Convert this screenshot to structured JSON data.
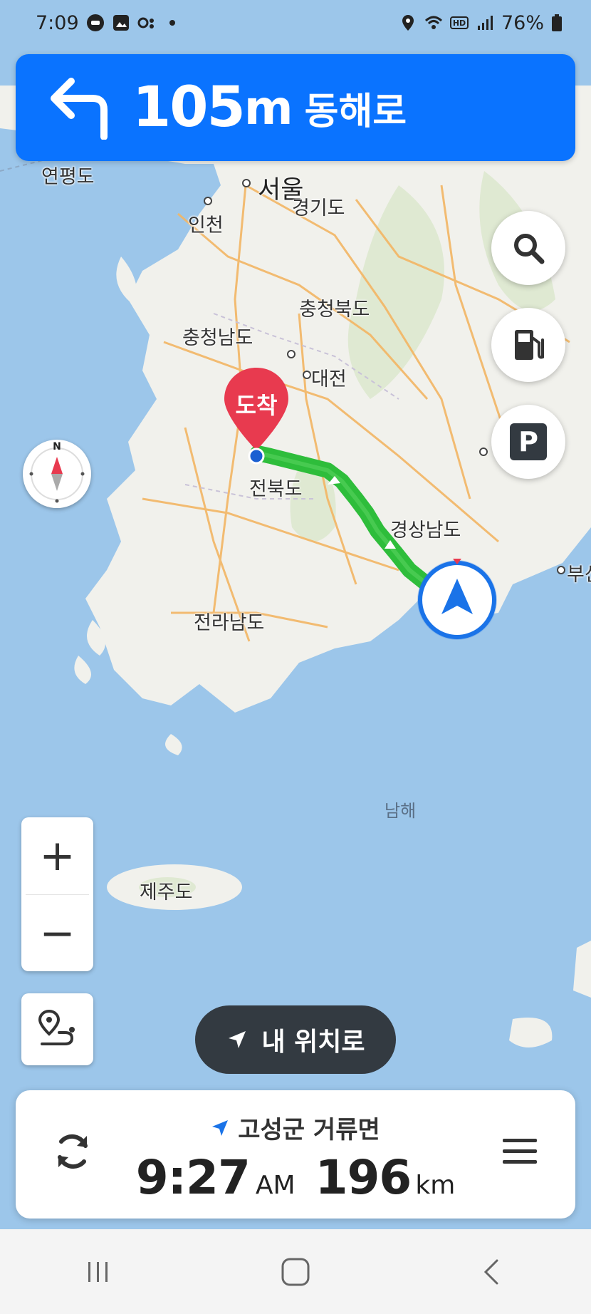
{
  "status_bar": {
    "time": "7:09",
    "battery": "76%",
    "icons_left": [
      "car-icon",
      "gallery-icon",
      "oo-icon",
      "dot-icon"
    ],
    "icons_right": [
      "location-icon",
      "wifi-icon",
      "hd-icon",
      "signal-icon",
      "battery-icon"
    ]
  },
  "guidance": {
    "turn_icon": "turn-left-arrow-icon",
    "distance": "105",
    "unit": "m",
    "road": "동해로"
  },
  "map": {
    "labels": {
      "yeonpyeong": "연평도",
      "seoul": "서울",
      "incheon": "인천",
      "gyeonggi": "경기도",
      "chungbuk": "충청북도",
      "chungnam": "충청남도",
      "daejeon": "대전",
      "jeonbuk": "전북도",
      "gyeongnam": "경상남도",
      "jeonnam": "전라남도",
      "busan": "부산",
      "namhae": "남해",
      "jeju": "제주도"
    },
    "destination_marker": "도착"
  },
  "fab_buttons": {
    "search": "search-icon",
    "fuel": "fuel-pump-icon",
    "parking": "P"
  },
  "compass": {
    "north": "N"
  },
  "zoom": {
    "in": "+",
    "out": "−"
  },
  "my_location_button": "내 위치로",
  "bottom_card": {
    "destination": "고성군 거류면",
    "eta_time": "9:27",
    "eta_ampm": "AM",
    "distance": "196",
    "distance_unit": "km"
  },
  "colors": {
    "accent": "#0a73ff",
    "route": "#2ebd3b",
    "destination_pin": "#e83a4f",
    "my_location_pill": "#333a41"
  }
}
